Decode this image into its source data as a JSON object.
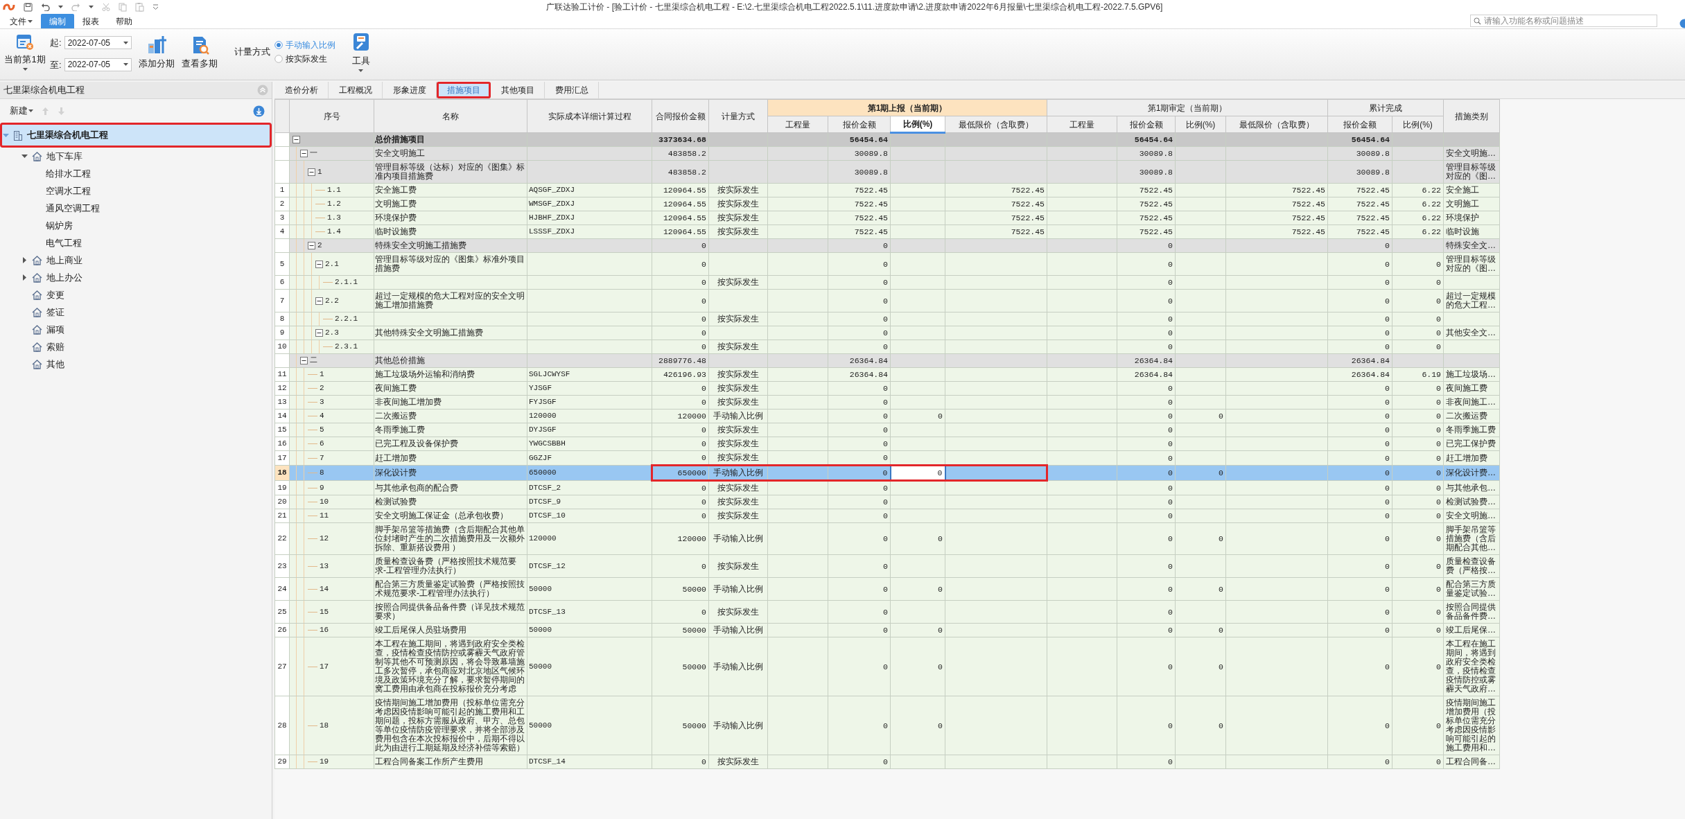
{
  "window": {
    "title": "广联达验工计价 - [验工计价 - 七里渠综合机电工程 - E:\\2.七里渠综合机电工程2022.5.1\\11.进度款申请\\2.进度款申请2022年6月报量\\七里渠综合机电工程-2022.7.5.GPV6]"
  },
  "menu": [
    {
      "label": "文件",
      "dropdown": true,
      "selected": false
    },
    {
      "label": "编制",
      "selected": true
    },
    {
      "label": "报表",
      "selected": false
    },
    {
      "label": "帮助",
      "selected": false
    }
  ],
  "search": {
    "placeholder": "请输入功能名称或问题描述"
  },
  "ribbon": {
    "period_button": "当前第1期",
    "start": {
      "label": "起:",
      "value": "2022-07-05"
    },
    "end": {
      "label": "至:",
      "value": "2022-07-05"
    },
    "buttons": [
      {
        "kind": "add_period",
        "label": "添加分期"
      },
      {
        "kind": "view_periods",
        "label": "查看多期"
      }
    ],
    "measure": {
      "label": "计量方式",
      "options": [
        {
          "label": "手动输入比例",
          "selected": true
        },
        {
          "label": "按实际发生",
          "selected": false
        }
      ]
    },
    "tools": "工具"
  },
  "sidebar": {
    "title": "七里渠综合机电工程",
    "new_button": "新建",
    "tree": [
      {
        "label": "七里渠综合机电工程",
        "kind": "project",
        "expanded": true,
        "selected": true,
        "highlighted": true,
        "children": [
          {
            "label": "地下车库",
            "kind": "unit",
            "expanded": true,
            "selected": false,
            "highlighted": false,
            "children": [
              {
                "label": "给排水工程",
                "kind": "subitem",
                "selected": false,
                "highlighted": false
              },
              {
                "label": "空调水工程",
                "kind": "subitem",
                "selected": false,
                "highlighted": false
              },
              {
                "label": "通风空调工程",
                "kind": "subitem",
                "selected": false,
                "highlighted": false
              },
              {
                "label": "锅炉房",
                "kind": "subitem",
                "selected": false,
                "highlighted": false
              },
              {
                "label": "电气工程",
                "kind": "subitem",
                "selected": false,
                "highlighted": false
              }
            ]
          },
          {
            "label": "地上商业",
            "kind": "unit",
            "expanded": false,
            "selected": false,
            "highlighted": false
          },
          {
            "label": "地上办公",
            "kind": "unit",
            "expanded": false,
            "selected": false,
            "highlighted": false
          },
          {
            "label": "变更",
            "kind": "unit",
            "selected": false,
            "highlighted": false
          },
          {
            "label": "签证",
            "kind": "unit",
            "selected": false,
            "highlighted": false
          },
          {
            "label": "漏项",
            "kind": "unit",
            "selected": false,
            "highlighted": false
          },
          {
            "label": "索赔",
            "kind": "unit",
            "selected": false,
            "highlighted": false
          },
          {
            "label": "其他",
            "kind": "unit",
            "selected": false,
            "highlighted": false
          }
        ]
      }
    ]
  },
  "tabs": [
    {
      "label": "造价分析",
      "selected": false,
      "highlighted": false
    },
    {
      "label": "工程概况",
      "selected": false,
      "highlighted": false
    },
    {
      "label": "形象进度",
      "selected": false,
      "highlighted": false
    },
    {
      "label": "措施项目",
      "selected": true,
      "highlighted": true
    },
    {
      "label": "其他项目",
      "selected": false,
      "highlighted": false
    },
    {
      "label": "费用汇总",
      "selected": false,
      "highlighted": false
    }
  ],
  "columns": [
    {
      "label": "序号"
    },
    {
      "label": "名称"
    },
    {
      "label": "实际成本详细计算过程"
    },
    {
      "label": "合同报价金额"
    },
    {
      "label": "计量方式"
    },
    {
      "label": "第1期上报（当前期）",
      "current": true,
      "children": [
        {
          "label": "工程量",
          "selected": false
        },
        {
          "label": "报价金额",
          "selected": false
        },
        {
          "label": "比例(%)",
          "selected": true
        },
        {
          "label": "最低限价（含取费）",
          "selected": false
        }
      ]
    },
    {
      "label": "第1期审定（当前期）",
      "current": false,
      "children": [
        {
          "label": "工程量",
          "selected": false
        },
        {
          "label": "报价金额",
          "selected": false
        },
        {
          "label": "比例(%)",
          "selected": false
        },
        {
          "label": "最低限价（含取费）",
          "selected": false
        }
      ]
    },
    {
      "label": "累计完成",
      "current": false,
      "children": [
        {
          "label": "报价金额",
          "selected": false
        },
        {
          "label": "比例(%)",
          "selected": false
        }
      ]
    },
    {
      "label": "措施类别"
    }
  ],
  "rows": [
    {
      "kind": "total",
      "expanded": true,
      "selected": false,
      "highlighted": false,
      "name": "总价措施项目",
      "contract": "3373634.68",
      "p_amount": "56454.64",
      "a_amount": "56454.64",
      "c_amount": "56454.64",
      "children": [
        {
          "kind": "group",
          "expanded": true,
          "selected": false,
          "highlighted": false,
          "code": "一",
          "name": "安全文明施工",
          "contract": "483858.2",
          "p_amount": "30089.8",
          "a_amount": "30089.8",
          "c_amount": "30089.8",
          "category": "安全文明施…",
          "children": [
            {
              "kind": "group",
              "expanded": true,
              "selected": false,
              "highlighted": false,
              "code": "1",
              "name": "管理目标等级（达标）对应的《图集》标准内项目措施费",
              "contract": "483858.2",
              "p_amount": "30089.8",
              "a_amount": "30089.8",
              "c_amount": "30089.8",
              "category": "管理目标等级对应的《图…",
              "children": [
                {
                  "kind": "item",
                  "selected": false,
                  "highlighted": false,
                  "no": "1",
                  "code": "1.1",
                  "name": "安全施工费",
                  "calc": "AQSGF_ZDXJ",
                  "contract": "120964.55",
                  "method": "按实际发生",
                  "p_amount": "7522.45",
                  "p_min": "7522.45",
                  "a_amount": "7522.45",
                  "a_min": "7522.45",
                  "c_amount": "7522.45",
                  "c_ratio": "6.22",
                  "category": "安全施工"
                },
                {
                  "kind": "item",
                  "selected": false,
                  "highlighted": false,
                  "no": "2",
                  "code": "1.2",
                  "name": "文明施工费",
                  "calc": "WMSGF_ZDXJ",
                  "contract": "120964.55",
                  "method": "按实际发生",
                  "p_amount": "7522.45",
                  "p_min": "7522.45",
                  "a_amount": "7522.45",
                  "a_min": "7522.45",
                  "c_amount": "7522.45",
                  "c_ratio": "6.22",
                  "category": "文明施工"
                },
                {
                  "kind": "item",
                  "selected": false,
                  "highlighted": false,
                  "no": "3",
                  "code": "1.3",
                  "name": "环境保护费",
                  "calc": "HJBHF_ZDXJ",
                  "contract": "120964.55",
                  "method": "按实际发生",
                  "p_amount": "7522.45",
                  "p_min": "7522.45",
                  "a_amount": "7522.45",
                  "a_min": "7522.45",
                  "c_amount": "7522.45",
                  "c_ratio": "6.22",
                  "category": "环境保护"
                },
                {
                  "kind": "item",
                  "selected": false,
                  "highlighted": false,
                  "no": "4",
                  "code": "1.4",
                  "name": "临时设施费",
                  "calc": "LSSSF_ZDXJ",
                  "contract": "120964.55",
                  "method": "按实际发生",
                  "p_amount": "7522.45",
                  "p_min": "7522.45",
                  "a_amount": "7522.45",
                  "a_min": "7522.45",
                  "c_amount": "7522.45",
                  "c_ratio": "6.22",
                  "category": "临时设施"
                }
              ]
            },
            {
              "kind": "group",
              "expanded": true,
              "selected": false,
              "highlighted": false,
              "code": "2",
              "name": "特殊安全文明施工措施费",
              "contract": "0",
              "p_amount": "0",
              "a_amount": "0",
              "c_amount": "0",
              "category": "特殊安全文…",
              "children": [
                {
                  "kind": "item",
                  "expanded": true,
                  "selected": false,
                  "highlighted": false,
                  "no": "5",
                  "code": "2.1",
                  "name": "管理目标等级对应的《图集》标准外项目措施费",
                  "contract": "0",
                  "p_amount": "0",
                  "a_amount": "0",
                  "c_amount": "0",
                  "c_ratio": "0",
                  "category": "管理目标等级对应的《图…",
                  "children": [
                    {
                      "kind": "item",
                      "selected": false,
                      "highlighted": false,
                      "no": "6",
                      "code": "2.1.1",
                      "contract": "0",
                      "method": "按实际发生",
                      "p_amount": "0",
                      "a_amount": "0",
                      "c_amount": "0",
                      "c_ratio": "0"
                    }
                  ]
                },
                {
                  "kind": "item",
                  "expanded": true,
                  "selected": false,
                  "highlighted": false,
                  "no": "7",
                  "code": "2.2",
                  "name": "超过一定规模的危大工程对应的安全文明施工增加措施费",
                  "contract": "0",
                  "p_amount": "0",
                  "a_amount": "0",
                  "c_amount": "0",
                  "c_ratio": "0",
                  "category": "超过一定规模的危大工程…",
                  "children": [
                    {
                      "kind": "item",
                      "selected": false,
                      "highlighted": false,
                      "no": "8",
                      "code": "2.2.1",
                      "contract": "0",
                      "method": "按实际发生",
                      "p_amount": "0",
                      "a_amount": "0",
                      "c_amount": "0",
                      "c_ratio": "0"
                    }
                  ]
                },
                {
                  "kind": "item",
                  "expanded": true,
                  "selected": false,
                  "highlighted": false,
                  "no": "9",
                  "code": "2.3",
                  "name": "其他特殊安全文明施工措施费",
                  "contract": "0",
                  "p_amount": "0",
                  "a_amount": "0",
                  "c_amount": "0",
                  "c_ratio": "0",
                  "category": "其他安全文…",
                  "children": [
                    {
                      "kind": "item",
                      "selected": false,
                      "highlighted": false,
                      "no": "10",
                      "code": "2.3.1",
                      "contract": "0",
                      "method": "按实际发生",
                      "p_amount": "0",
                      "a_amount": "0",
                      "c_amount": "0",
                      "c_ratio": "0"
                    }
                  ]
                }
              ]
            }
          ]
        },
        {
          "kind": "group",
          "expanded": true,
          "selected": false,
          "highlighted": false,
          "code": "二",
          "name": "其他总价措施",
          "contract": "2889776.48",
          "p_amount": "26364.84",
          "a_amount": "26364.84",
          "c_amount": "26364.84",
          "children": [
            {
              "kind": "item",
              "selected": false,
              "highlighted": false,
              "no": "11",
              "code": "1",
              "name": "施工垃圾场外运输和消纳费",
              "calc": "SGLJCWYSF",
              "contract": "426196.93",
              "method": "按实际发生",
              "p_amount": "26364.84",
              "a_amount": "26364.84",
              "c_amount": "26364.84",
              "c_ratio": "6.19",
              "category": "施工垃圾场…"
            },
            {
              "kind": "item",
              "selected": false,
              "highlighted": false,
              "no": "12",
              "code": "2",
              "name": "夜间施工费",
              "calc": "YJSGF",
              "contract": "0",
              "method": "按实际发生",
              "p_amount": "0",
              "a_amount": "0",
              "c_amount": "0",
              "c_ratio": "0",
              "category": "夜间施工费"
            },
            {
              "kind": "item",
              "selected": false,
              "highlighted": false,
              "no": "13",
              "code": "3",
              "name": "非夜间施工增加费",
              "calc": "FYJSGF",
              "contract": "0",
              "method": "按实际发生",
              "p_amount": "0",
              "a_amount": "0",
              "c_amount": "0",
              "c_ratio": "0",
              "category": "非夜间施工…"
            },
            {
              "kind": "item",
              "selected": false,
              "highlighted": false,
              "no": "14",
              "code": "4",
              "name": "二次搬运费",
              "calc": "120000",
              "contract": "120000",
              "method": "手动输入比例",
              "p_amount": "0",
              "p_ratio": "0",
              "a_amount": "0",
              "a_ratio": "0",
              "c_amount": "0",
              "c_ratio": "0",
              "category": "二次搬运费"
            },
            {
              "kind": "item",
              "selected": false,
              "highlighted": false,
              "no": "15",
              "code": "5",
              "name": "冬雨季施工费",
              "calc": "DYJSGF",
              "contract": "0",
              "method": "按实际发生",
              "p_amount": "0",
              "a_amount": "0",
              "c_amount": "0",
              "c_ratio": "0",
              "category": "冬雨季施工费"
            },
            {
              "kind": "item",
              "selected": false,
              "highlighted": false,
              "no": "16",
              "code": "6",
              "name": "已完工程及设备保护费",
              "calc": "YWGCSBBH",
              "contract": "0",
              "method": "按实际发生",
              "p_amount": "0",
              "a_amount": "0",
              "c_amount": "0",
              "c_ratio": "0",
              "category": "已完工保护费"
            },
            {
              "kind": "item",
              "selected": false,
              "highlighted": false,
              "no": "17",
              "code": "7",
              "name": "赶工增加费",
              "calc": "GGZJF",
              "contract": "0",
              "method": "按实际发生",
              "p_amount": "0",
              "a_amount": "0",
              "c_amount": "0",
              "c_ratio": "0",
              "category": "赶工增加费"
            },
            {
              "kind": "item",
              "selected": true,
              "highlighted": true,
              "no": "18",
              "code": "8",
              "name": "深化设计费",
              "calc": "650000",
              "contract": "650000",
              "method": "手动输入比例",
              "p_amount": "0",
              "p_ratio": "0",
              "a_amount": "0",
              "a_ratio": "0",
              "c_amount": "0",
              "c_ratio": "0",
              "category": "深化设计费…"
            },
            {
              "kind": "item",
              "selected": false,
              "highlighted": false,
              "no": "19",
              "code": "9",
              "name": "与其他承包商的配合费",
              "calc": "DTCSF_2",
              "contract": "0",
              "method": "按实际发生",
              "p_amount": "0",
              "a_amount": "0",
              "c_amount": "0",
              "c_ratio": "0",
              "category": "与其他承包…"
            },
            {
              "kind": "item",
              "selected": false,
              "highlighted": false,
              "no": "20",
              "code": "10",
              "name": "检测试验费",
              "calc": "DTCSF_9",
              "contract": "0",
              "method": "按实际发生",
              "p_amount": "0",
              "a_amount": "0",
              "c_amount": "0",
              "c_ratio": "0",
              "category": "检测试验费…"
            },
            {
              "kind": "item",
              "selected": false,
              "highlighted": false,
              "no": "21",
              "code": "11",
              "name": "安全文明施工保证金（总承包收费）",
              "calc": "DTCSF_10",
              "contract": "0",
              "method": "按实际发生",
              "p_amount": "0",
              "a_amount": "0",
              "c_amount": "0",
              "c_ratio": "0",
              "category": "安全文明施…"
            },
            {
              "kind": "item",
              "selected": false,
              "highlighted": false,
              "no": "22",
              "code": "12",
              "name": "脚手架吊篮等措施费（含后期配合其他单位封堵时产生的二次措施费用及一次额外拆除、重新搭设费用 ）",
              "calc": "120000",
              "contract": "120000",
              "method": "手动输入比例",
              "p_amount": "0",
              "p_ratio": "0",
              "a_amount": "0",
              "a_ratio": "0",
              "c_amount": "0",
              "c_ratio": "0",
              "category": "脚手架吊篮等措施费（含后期配合其他…"
            },
            {
              "kind": "item",
              "selected": false,
              "highlighted": false,
              "no": "23",
              "code": "13",
              "name": "质量检查设备费（严格按照技术规范要求-工程管理办法执行）",
              "calc": "DTCSF_12",
              "contract": "0",
              "method": "按实际发生",
              "p_amount": "0",
              "a_amount": "0",
              "c_amount": "0",
              "c_ratio": "0",
              "category": "质量检查设备费（严格按…"
            },
            {
              "kind": "item",
              "selected": false,
              "highlighted": false,
              "no": "24",
              "code": "14",
              "name": "配合第三方质量鉴定试验费（严格按照技术规范要求-工程管理办法执行）",
              "calc": "50000",
              "contract": "50000",
              "method": "手动输入比例",
              "p_amount": "0",
              "p_ratio": "0",
              "a_amount": "0",
              "a_ratio": "0",
              "c_amount": "0",
              "c_ratio": "0",
              "category": "配合第三方质量鉴定试验…"
            },
            {
              "kind": "item",
              "selected": false,
              "highlighted": false,
              "no": "25",
              "code": "15",
              "name": "按照合同提供备品备件费（详见技术规范要求）",
              "calc": "DTCSF_13",
              "contract": "0",
              "method": "按实际发生",
              "p_amount": "0",
              "a_amount": "0",
              "c_amount": "0",
              "c_ratio": "0",
              "category": "按照合同提供备品备件费…"
            },
            {
              "kind": "item",
              "selected": false,
              "highlighted": false,
              "no": "26",
              "code": "16",
              "name": "竣工后尾保人员驻场费用",
              "calc": "50000",
              "contract": "50000",
              "method": "手动输入比例",
              "p_amount": "0",
              "p_ratio": "0",
              "a_amount": "0",
              "a_ratio": "0",
              "c_amount": "0",
              "c_ratio": "0",
              "category": "竣工后尾保…"
            },
            {
              "kind": "item",
              "selected": false,
              "highlighted": false,
              "no": "27",
              "code": "17",
              "name": "本工程在施工期间，将遇到政府安全类检查，疫情检查疫情防控或雾霾天气政府管制等其他不可预测原因，将会导致幕墙施工多次暂停，承包商应对北京地区气候环境及政策环境充分了解，要求暂停期间的窝工费用由承包商在投标报价充分考虑",
              "calc": "50000",
              "contract": "50000",
              "method": "手动输入比例",
              "p_amount": "0",
              "p_ratio": "0",
              "a_amount": "0",
              "a_ratio": "0",
              "c_amount": "0",
              "c_ratio": "0",
              "category": "本工程在施工期间，将遇到政府安全类检查，疫情检查疫情防控或雾霾天气政府…"
            },
            {
              "kind": "item",
              "selected": false,
              "highlighted": false,
              "no": "28",
              "code": "18",
              "name": "疫情期间施工增加费用（投标单位需充分考虑因疫情影响可能引起的施工费用和工期问题，投标方需服从政府、甲方、总包等单位疫情防疫管理要求，并将全部涉及费用包含在本次投标报价中，后期不得以此为由进行工期延期及经济补偿等索赔）",
              "calc": "50000",
              "contract": "50000",
              "method": "手动输入比例",
              "p_amount": "0",
              "p_ratio": "0",
              "a_amount": "0",
              "a_ratio": "0",
              "c_amount": "0",
              "c_ratio": "0",
              "category": "疫情期间施工增加费用（投标单位需充分考虑因疫情影响可能引起的施工费用和…"
            },
            {
              "kind": "item",
              "selected": false,
              "highlighted": false,
              "no": "29",
              "code": "19",
              "name": "工程合同备案工作所产生费用",
              "calc": "DTCSF_14",
              "contract": "0",
              "method": "按实际发生",
              "p_amount": "0",
              "a_amount": "0",
              "c_amount": "0",
              "c_ratio": "0",
              "category": "工程合同备…"
            }
          ]
        }
      ]
    }
  ]
}
